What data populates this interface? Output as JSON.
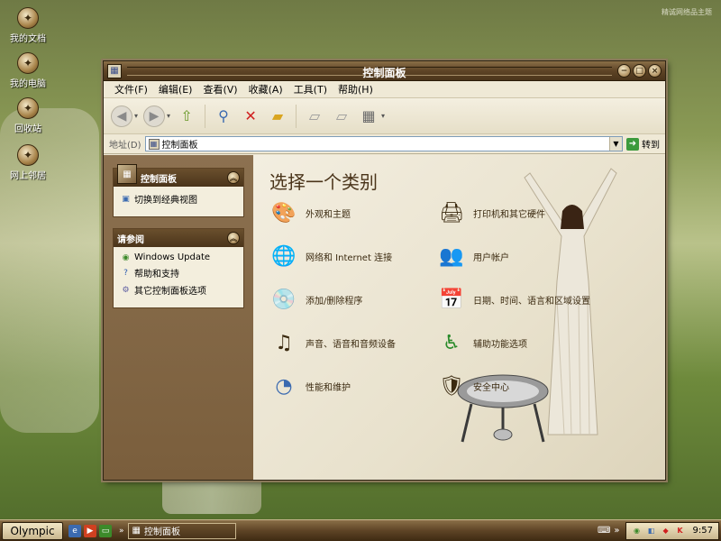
{
  "wallpaper": {
    "watermark": "精诚网络品主题"
  },
  "desktop": {
    "icons": [
      {
        "label": "我的文档"
      },
      {
        "label": "我的电脑"
      },
      {
        "label": "回收站"
      },
      {
        "label": "网上邻居"
      }
    ]
  },
  "window": {
    "title": "控制面板",
    "menu": [
      "文件(F)",
      "编辑(E)",
      "查看(V)",
      "收藏(A)",
      "工具(T)",
      "帮助(H)"
    ],
    "address_label": "地址(D)",
    "address_value": "控制面板",
    "go_label": "转到"
  },
  "left_panel": {
    "control_panel": {
      "title": "控制面板",
      "links": [
        "切换到经典视图"
      ]
    },
    "see_also": {
      "title": "请参阅",
      "links": [
        "Windows Update",
        "帮助和支持",
        "其它控制面板选项"
      ]
    }
  },
  "main": {
    "heading": "选择一个类别",
    "categories": [
      {
        "label": "外观和主题",
        "icon": "appearance-icon"
      },
      {
        "label": "打印机和其它硬件",
        "icon": "printer-icon"
      },
      {
        "label": "网络和 Internet 连接",
        "icon": "network-icon"
      },
      {
        "label": "用户帐户",
        "icon": "users-icon"
      },
      {
        "label": "添加/删除程序",
        "icon": "programs-icon"
      },
      {
        "label": "日期、时间、语言和区域设置",
        "icon": "datetime-icon"
      },
      {
        "label": "声音、语音和音频设备",
        "icon": "sound-icon"
      },
      {
        "label": "辅助功能选项",
        "icon": "accessibility-icon"
      },
      {
        "label": "性能和维护",
        "icon": "performance-icon"
      },
      {
        "label": "安全中心",
        "icon": "security-shield-icon"
      }
    ]
  },
  "taskbar": {
    "start_label": "Olympic",
    "task_label": "控制面板",
    "clock": "9:57"
  }
}
